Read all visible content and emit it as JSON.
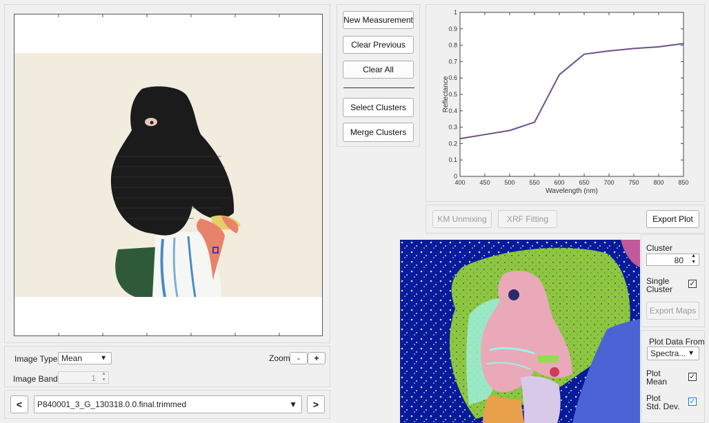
{
  "buttons": {
    "new_measurement": "New Measurement",
    "clear_previous": "Clear Previous",
    "clear_all": "Clear All",
    "select_clusters": "Select Clusters",
    "merge_clusters": "Merge Clusters",
    "km_unmixing": "KM Unmixing",
    "xrf_fitting": "XRF Fitting",
    "export_plot": "Export Plot",
    "export_maps": "Export Maps",
    "nav_prev": "<",
    "nav_next": ">",
    "zoom_out": "-",
    "zoom_in": "+"
  },
  "image_controls": {
    "image_type_label": "Image Type",
    "image_type_value": "Mean",
    "zoom_label": "Zoom",
    "image_band_label": "Image Band",
    "image_band_value": "1",
    "file_name": "P840001_3_G_130318.0.0.final.trimmed"
  },
  "cluster_controls": {
    "cluster_label": "Cluster",
    "cluster_value": "80",
    "single_cluster_label_1": "Single",
    "single_cluster_label_2": "Cluster",
    "plot_data_from_label": "Plot Data From",
    "plot_data_from_value": "Spectra...",
    "plot_mean_label_1": "Plot",
    "plot_mean_label_2": "Mean",
    "plot_std_label_1": "Plot",
    "plot_std_label_2": "Std. Dev."
  },
  "colors": {
    "line": "#6a4f8a",
    "cluster_bg": "#0a1a9a",
    "cluster_green": "#8ec63f",
    "cluster_pink": "#e9a9b8",
    "cluster_cyan": "#9ff0e6"
  },
  "chart_data": {
    "type": "line",
    "xlabel": "Wavelength (nm)",
    "ylabel": "Reflectance",
    "xlim": [
      400,
      850
    ],
    "ylim": [
      0,
      1
    ],
    "xticks": [
      400,
      450,
      500,
      550,
      600,
      650,
      700,
      750,
      800,
      850
    ],
    "yticks": [
      0,
      0.1,
      0.2,
      0.3,
      0.4,
      0.5,
      0.6,
      0.7,
      0.8,
      0.9,
      1
    ],
    "series": [
      {
        "x": [
          400,
          450,
          500,
          550,
          600,
          650,
          700,
          750,
          800,
          850
        ],
        "values": [
          0.23,
          0.255,
          0.28,
          0.33,
          0.62,
          0.745,
          0.765,
          0.78,
          0.79,
          0.81
        ]
      }
    ]
  }
}
